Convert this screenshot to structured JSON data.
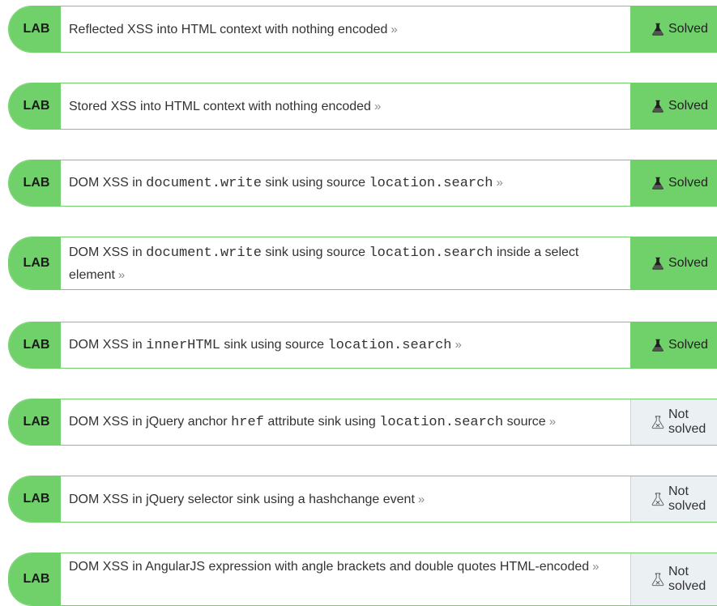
{
  "badge_label": "LAB",
  "chevron": "»",
  "statuses": {
    "solved": "Solved",
    "not_solved": "Not solved"
  },
  "labs": [
    {
      "parts": [
        {
          "t": "Reflected XSS into HTML context with nothing encoded"
        }
      ],
      "status": "solved"
    },
    {
      "parts": [
        {
          "t": "Stored XSS into HTML context with nothing encoded"
        }
      ],
      "status": "solved"
    },
    {
      "parts": [
        {
          "t": "DOM XSS in "
        },
        {
          "c": "document.write"
        },
        {
          "t": " sink using source "
        },
        {
          "c": "location.search"
        }
      ],
      "status": "solved"
    },
    {
      "parts": [
        {
          "t": "DOM XSS in "
        },
        {
          "c": "document.write"
        },
        {
          "t": " sink using source "
        },
        {
          "c": "location.search"
        },
        {
          "t": " inside a select element"
        }
      ],
      "status": "solved"
    },
    {
      "parts": [
        {
          "t": "DOM XSS in "
        },
        {
          "c": "innerHTML"
        },
        {
          "t": " sink using source "
        },
        {
          "c": "location.search"
        }
      ],
      "status": "solved"
    },
    {
      "parts": [
        {
          "t": "DOM XSS in jQuery anchor "
        },
        {
          "c": "href"
        },
        {
          "t": " attribute sink using "
        },
        {
          "c": "location.search"
        },
        {
          "t": " source"
        }
      ],
      "status": "not_solved"
    },
    {
      "parts": [
        {
          "t": "DOM XSS in jQuery selector sink using a hashchange event"
        }
      ],
      "status": "not_solved"
    },
    {
      "parts": [
        {
          "t": "DOM XSS in AngularJS expression with angle brackets and double quotes HTML-encoded"
        }
      ],
      "status": "not_solved"
    }
  ],
  "colors": {
    "accent_green": "#70d16a",
    "not_solved_bg": "#ebf0f2",
    "text": "#333333"
  },
  "icons": {
    "solved": "flask-filled-icon",
    "not_solved": "flask-outline-icon"
  }
}
